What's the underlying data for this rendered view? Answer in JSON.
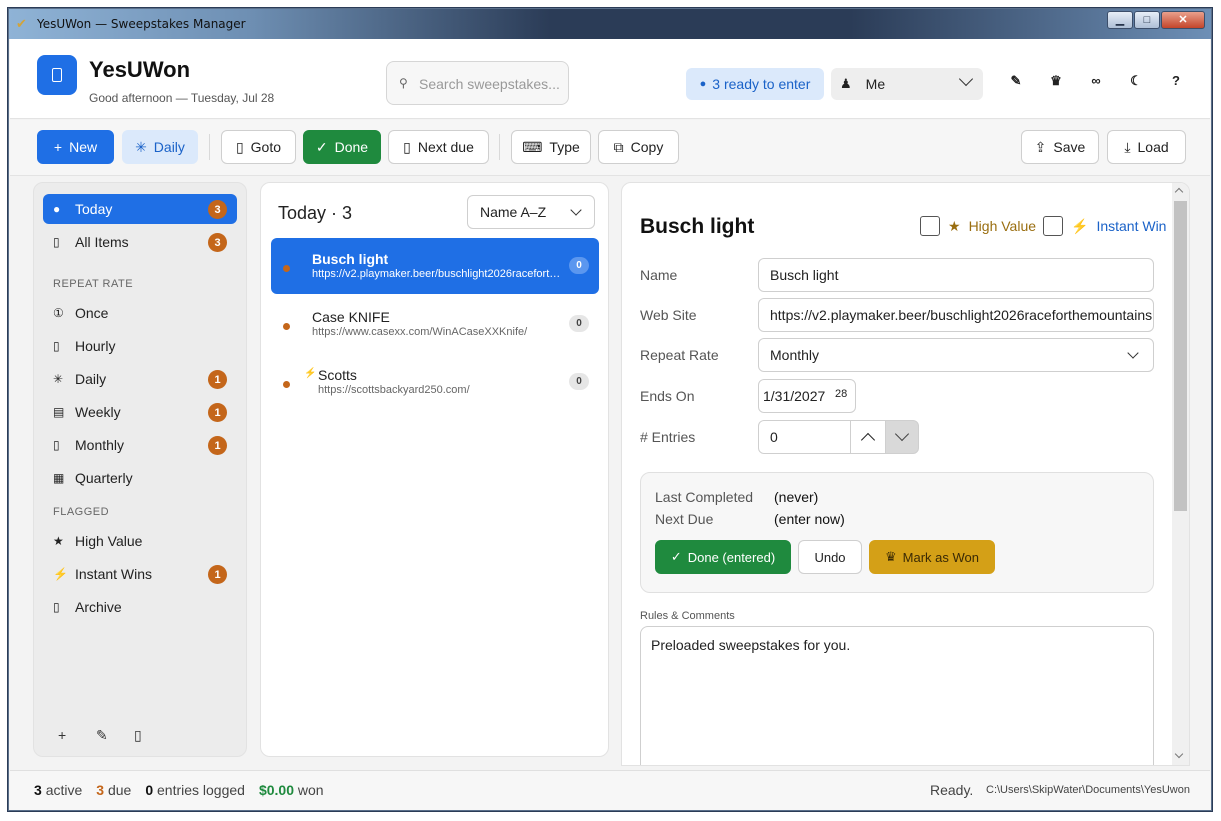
{
  "window": {
    "title": "YesUWon — Sweepstakes Manager",
    "minimize": "▁",
    "maximize": "□",
    "close": "✕"
  },
  "header": {
    "app_name": "YesUWon",
    "greeting": "Good afternoon — Tuesday, Jul 28",
    "search_placeholder": "Search sweepstakes...",
    "ready_label": "3 ready to enter",
    "user": "Me",
    "icons": [
      "brush-icon",
      "trophy-icon",
      "link-icon",
      "moon-icon",
      "help-icon"
    ]
  },
  "toolbar": {
    "new": "New",
    "daily": "Daily",
    "goto": "Goto",
    "done": "Done",
    "next_due": "Next due",
    "type": "Type",
    "copy": "Copy",
    "save": "Save",
    "load": "Load"
  },
  "sidebar": {
    "items": [
      {
        "label": "Today",
        "badge": "3",
        "icon": "drop-icon"
      },
      {
        "label": "All Items",
        "badge": "3",
        "icon": "box-icon"
      }
    ],
    "repeat_header": "REPEAT RATE",
    "repeat": [
      {
        "label": "Once",
        "badge": "",
        "icon": "one-icon"
      },
      {
        "label": "Hourly",
        "badge": "",
        "icon": "box-icon"
      },
      {
        "label": "Daily",
        "badge": "1",
        "icon": "sun-icon"
      },
      {
        "label": "Weekly",
        "badge": "1",
        "icon": "calendar-icon"
      },
      {
        "label": "Monthly",
        "badge": "1",
        "icon": "box-icon"
      },
      {
        "label": "Quarterly",
        "badge": "",
        "icon": "grid-icon"
      }
    ],
    "flagged_header": "FLAGGED",
    "flagged": [
      {
        "label": "High Value",
        "badge": "",
        "icon": "star-icon"
      },
      {
        "label": "Instant Wins",
        "badge": "1",
        "icon": "bolt-icon"
      },
      {
        "label": "Archive",
        "badge": "",
        "icon": "box-icon"
      }
    ]
  },
  "list": {
    "title": "Today",
    "count": "3",
    "sort": "Name A–Z",
    "rows": [
      {
        "title": "Busch light",
        "url": "https://v2.playmaker.beer/buschlight2026raceforthemountains",
        "count": "0"
      },
      {
        "title": "Case KNIFE",
        "url": "https://www.casexx.com/WinACaseXXKnife/",
        "count": "0"
      },
      {
        "title": "Scotts",
        "url": "https://scottsbackyard250.com/",
        "count": "0"
      }
    ]
  },
  "detail": {
    "title": "Busch light",
    "high_value": "High Value",
    "instant_win": "Instant Win",
    "fields": {
      "name_label": "Name",
      "name": "Busch light",
      "site_label": "Web Site",
      "site": "https://v2.playmaker.beer/buschlight2026raceforthemountains",
      "repeat_label": "Repeat Rate",
      "repeat": "Monthly",
      "ends_label": "Ends On",
      "ends": "1/31/2027",
      "ends_day": "28",
      "entries_label": "# Entries",
      "entries": "0"
    },
    "status": {
      "last_label": "Last Completed",
      "last": "(never)",
      "next_label": "Next Due",
      "next": "(enter now)",
      "done_btn": "Done (entered)",
      "undo_btn": "Undo",
      "won_btn": "Mark as Won"
    },
    "rules_label": "Rules & Comments",
    "rules": "Preloaded sweepstakes for you."
  },
  "statusbar": {
    "active_n": "3",
    "active": "active",
    "due_n": "3",
    "due": "due",
    "entries_n": "0",
    "entries": "entries logged",
    "won_n": "$0.00",
    "won": "won",
    "ready": "Ready.",
    "path": "C:\\Users\\SkipWater\\Documents\\YesUwon"
  },
  "colors": {
    "accent": "#1f6fe5",
    "success": "#1f8a3e",
    "badge": "#c4661a",
    "gold": "#d4a017"
  }
}
